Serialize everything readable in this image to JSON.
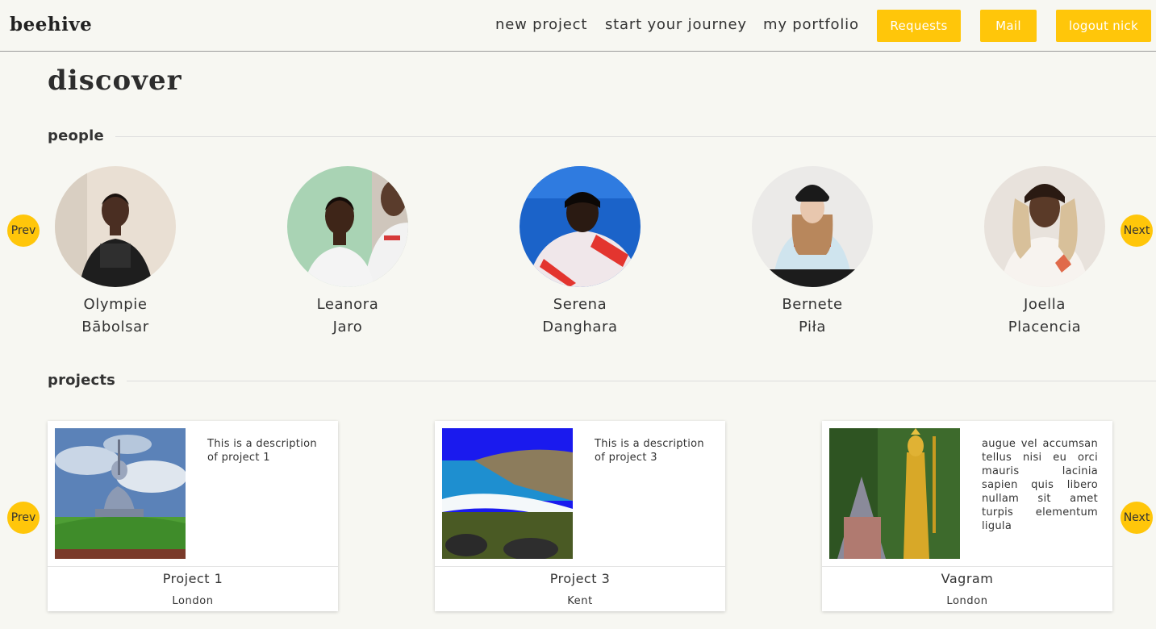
{
  "header": {
    "logo": "beehive",
    "nav": [
      "new project",
      "start your journey",
      "my portfolio"
    ],
    "buttons": [
      "Requests",
      "Mail",
      "logout nick"
    ]
  },
  "page": {
    "title": "discover"
  },
  "people": {
    "label": "people",
    "prev": "Prev",
    "next": "Next",
    "items": [
      {
        "first": "Olympie",
        "last": "Bābolsar"
      },
      {
        "first": "Leanora",
        "last": "Jaro"
      },
      {
        "first": "Serena",
        "last": "Danghara"
      },
      {
        "first": "Bernete",
        "last": "Piła"
      },
      {
        "first": "Joella",
        "last": "Placencia"
      }
    ]
  },
  "projects": {
    "label": "projects",
    "prev": "Prev",
    "next": "Next",
    "items": [
      {
        "description": "This is a description of project 1",
        "title": "Project 1",
        "location": "London"
      },
      {
        "description": "This is a description of project 3",
        "title": "Project 3",
        "location": "Kent"
      },
      {
        "description": "augue vel accumsan tellus nisi eu orci mauris lacinia sapien quis libero nullam sit amet turpis elementum ligula",
        "title": "Vagram",
        "location": "London"
      }
    ]
  },
  "colors": {
    "accent": "#ffc60a",
    "background": "#f7f7f2",
    "text": "#333333"
  }
}
